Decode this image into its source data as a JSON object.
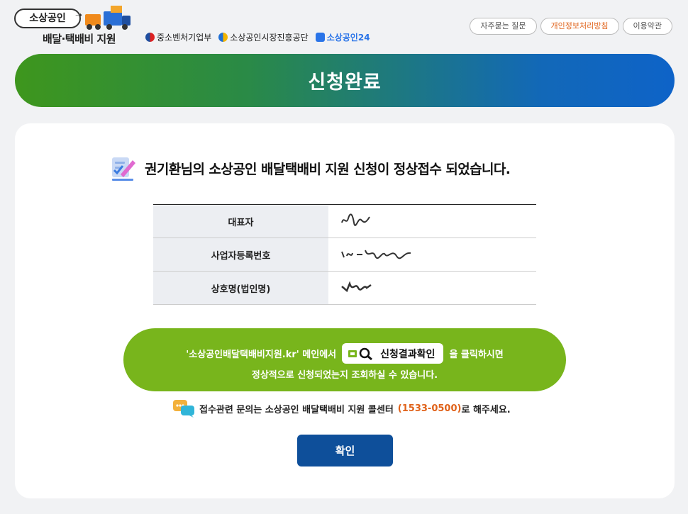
{
  "header": {
    "logo_top": "소상공인",
    "logo_bottom": "배달·택배비 지원",
    "orgs": [
      "중소벤처기업부",
      "소상공인시장진흥공단",
      "소상공인24"
    ],
    "links": [
      "자주묻는 질문",
      "개인정보처리방침",
      "이용약관"
    ]
  },
  "banner": {
    "title": "신청완료"
  },
  "result": {
    "message": "권기환님의 소상공인 배달택배비 지원 신청이 정상접수 되었습니다.",
    "rows": [
      {
        "label": "대표자"
      },
      {
        "label": "사업자등록번호"
      },
      {
        "label": "상호명(법인명)"
      }
    ]
  },
  "notice": {
    "prefix": "'소상공인배달택배비지원.kr' 메인에서",
    "button_label": "신청결과확인",
    "suffix": "을 클릭하시면",
    "line2": "정상적으로 신청되었는지 조회하실 수 있습니다."
  },
  "callcenter": {
    "prefix": "접수관련 문의는 소상공인 배달택배비 지원 콜센터",
    "phone": "(1533-0500)",
    "suffix": "로 해주세요."
  },
  "confirm_label": "확인",
  "colors": {
    "banner_start": "#3e961d",
    "banner_end": "#0e63c8",
    "notice_green": "#78b51c",
    "button_blue": "#0e4f9a",
    "accent_orange": "#e0621a"
  }
}
